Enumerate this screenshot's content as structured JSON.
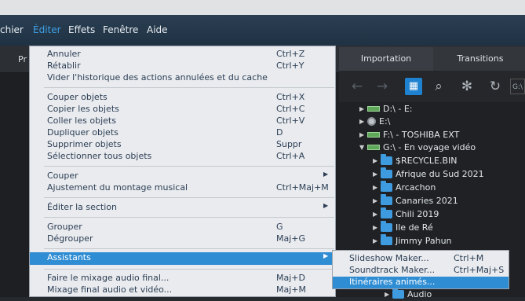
{
  "menubar": {
    "fichier": "chier",
    "editer": "Éditer",
    "effets": "Effets",
    "fenetre": "Fenêtre",
    "aide": "Aide"
  },
  "toolbar": {
    "pr": "Pr"
  },
  "panel": {
    "tabs": [
      "Importation",
      "Transitions"
    ],
    "path": "G:\\",
    "tree": [
      "D:\\ - E:",
      "E:\\",
      "F:\\ - TOSHIBA EXT",
      "G:\\ - En voyage vidéo",
      "$RECYCLE.BIN",
      "Afrique du Sud 2021",
      "Arcachon",
      "Canaries 2021",
      "Chili 2019",
      "Ile de Ré",
      "Jimmy Pahun",
      "Audio"
    ]
  },
  "menu": {
    "annuler": "Annuler",
    "annuler_sc": "Ctrl+Z",
    "retablir": "Rétablir",
    "retablir_sc": "Ctrl+Y",
    "vider": "Vider l'historique des actions annulées et du cache",
    "couper_objets": "Couper objets",
    "couper_objets_sc": "Ctrl+X",
    "copier_objets": "Copier les objets",
    "copier_objets_sc": "Ctrl+C",
    "coller_objets": "Coller les objets",
    "coller_objets_sc": "Ctrl+V",
    "dupliquer": "Dupliquer objets",
    "dupliquer_sc": "D",
    "supprimer": "Supprimer objets",
    "supprimer_sc": "Suppr",
    "selectionner": "Sélectionner tous objets",
    "selectionner_sc": "Ctrl+A",
    "couper": "Couper",
    "ajustement": "Ajustement du montage musical",
    "ajustement_sc": "Ctrl+Maj+M",
    "editer_section": "Éditer la section",
    "grouper": "Grouper",
    "grouper_sc": "G",
    "degrouper": "Dégrouper",
    "degrouper_sc": "Maj+G",
    "assistants": "Assistants",
    "mixage": "Faire le mixage audio final...",
    "mixage_sc": "Maj+D",
    "mixage_video": "Mixage final audio et vidéo...",
    "mixage_video_sc": "Maj+M"
  },
  "submenu": {
    "slideshow": "Slideshow Maker...",
    "slideshow_sc": "Ctrl+M",
    "soundtrack": "Soundtrack Maker...",
    "soundtrack_sc": "Ctrl+Maj+S",
    "itineraires": "Itinéraires animés..."
  },
  "colors": {
    "accent": "#2f8dd4",
    "menubar": "#2b3f52",
    "menu_bg": "#e9ebee",
    "menu_text": "#2c3e55"
  }
}
